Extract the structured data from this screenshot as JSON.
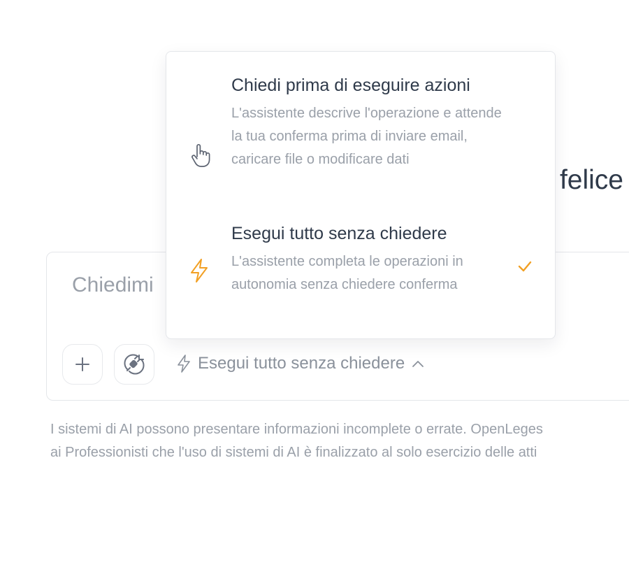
{
  "greeting": {
    "text": "felice"
  },
  "composer": {
    "placeholder": "Chiedimi",
    "mode_label": "Esegui tutto senza chiedere"
  },
  "mode_menu": {
    "options": [
      {
        "title": "Chiedi prima di eseguire azioni",
        "description": "L'assistente descrive l'operazione e attende la tua conferma prima di inviare email, caricare file o modificare dati",
        "icon": "hand-pointer-icon",
        "selected": false
      },
      {
        "title": "Esegui tutto senza chiedere",
        "description": "L'assistente completa le operazioni in autonomia senza chiedere conferma",
        "icon": "lightning-icon",
        "selected": true
      }
    ]
  },
  "disclaimer": {
    "line1": "I sistemi di AI possono presentare informazioni incomplete o errate. OpenLeges",
    "line2": "ai Professionisti che l'uso di sistemi di AI è finalizzato al solo esercizio delle atti"
  },
  "colors": {
    "accent": "#f2a024",
    "text": "#2f3a4a",
    "muted": "#9aa0a9",
    "border": "#e4e6ea"
  }
}
